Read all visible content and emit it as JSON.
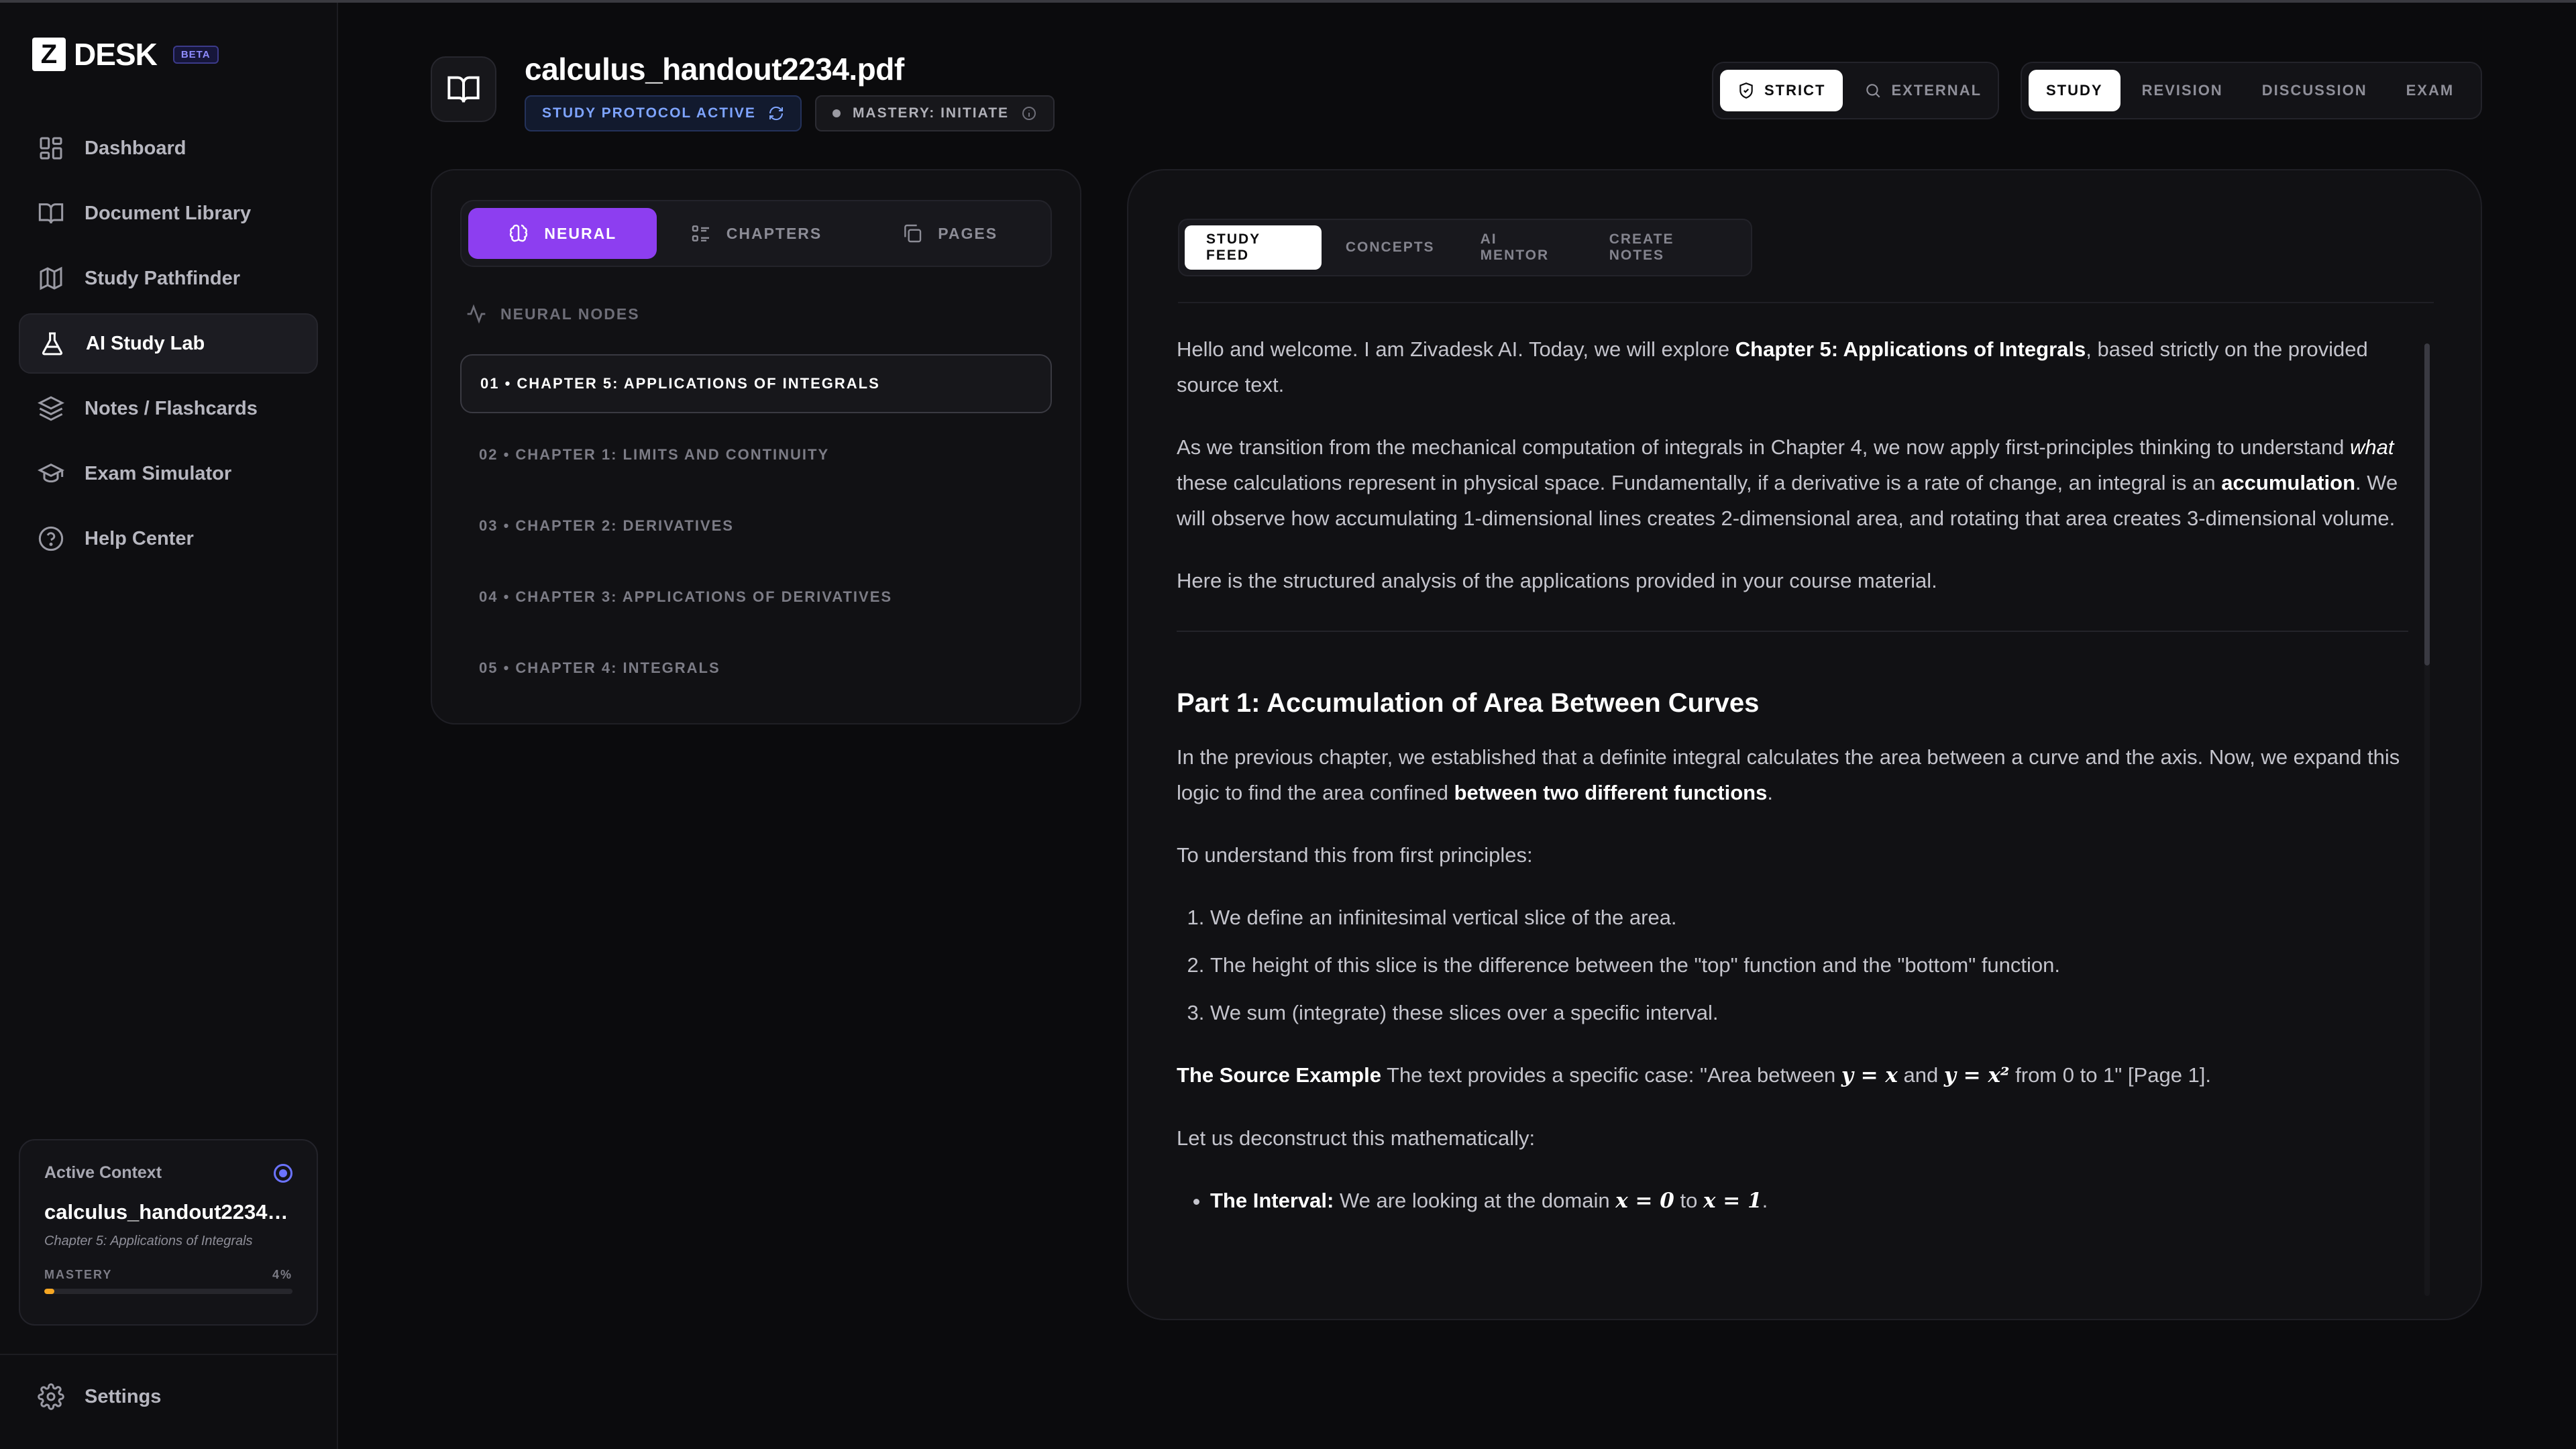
{
  "app": {
    "logo_mark": "Z",
    "logo_text": "DESK",
    "beta": "BETA"
  },
  "sidebar": {
    "items": [
      {
        "label": "Dashboard"
      },
      {
        "label": "Document Library"
      },
      {
        "label": "Study Pathfinder"
      },
      {
        "label": "AI Study Lab"
      },
      {
        "label": "Notes / Flashcards"
      },
      {
        "label": "Exam Simulator"
      },
      {
        "label": "Help Center"
      }
    ],
    "context": {
      "heading": "Active Context",
      "file": "calculus_handout2234.pdf",
      "chapter": "Chapter 5: Applications of Integrals",
      "mastery_label": "MASTERY",
      "mastery_value": "4%",
      "mastery_fraction": 0.04
    },
    "settings": "Settings"
  },
  "header": {
    "title": "calculus_handout2234.pdf",
    "protocol_badge": "STUDY PROTOCOL ACTIVE",
    "mastery_badge": "MASTERY: INITIATE",
    "source_modes": [
      "STRICT",
      "EXTERNAL"
    ],
    "study_modes": [
      "STUDY",
      "REVISION",
      "DISCUSSION",
      "EXAM"
    ]
  },
  "left_panel": {
    "tabs": [
      "NEURAL",
      "CHAPTERS",
      "PAGES"
    ],
    "nodes_heading": "NEURAL NODES",
    "nodes": [
      "01 • CHAPTER 5: APPLICATIONS OF INTEGRALS",
      "02 • CHAPTER 1: LIMITS AND CONTINUITY",
      "03 • CHAPTER 2: DERIVATIVES",
      "04 • CHAPTER 3: APPLICATIONS OF DERIVATIVES",
      "05 • CHAPTER 4: INTEGRALS"
    ]
  },
  "feed": {
    "tabs": [
      "STUDY FEED",
      "CONCEPTS",
      "AI MENTOR",
      "CREATE NOTES"
    ],
    "p1_a": "Hello and welcome. I am Zivadesk AI. Today, we will explore ",
    "p1_b": "Chapter 5: Applications of Integrals",
    "p1_c": ", based strictly on the provided source text.",
    "p2_a": "As we transition from the mechanical computation of integrals in Chapter 4, we now apply first-principles thinking to understand ",
    "p2_b": "what",
    "p2_c": " these calculations represent in physical space. Fundamentally, if a derivative is a rate of change, an integral is an ",
    "p2_d": "accumulation",
    "p2_e": ". We will observe how accumulating 1-dimensional lines creates 2-dimensional area, and rotating that area creates 3-dimensional volume.",
    "p3": "Here is the structured analysis of the applications provided in your course material.",
    "h2": "Part 1: Accumulation of Area Between Curves",
    "p4_a": "In the previous chapter, we established that a definite integral calculates the area between a curve and the axis. Now, we expand this logic to find the area confined ",
    "p4_b": "between two different functions",
    "p4_c": ".",
    "p5": "To understand this from first principles:",
    "steps": [
      "We define an infinitesimal vertical slice of the area.",
      "The height of this slice is the difference between the \"top\" function and the \"bottom\" function.",
      "We sum (integrate) these slices over a specific interval."
    ],
    "p6_label": "The Source Example",
    "p6_a": " The text provides a specific case: \"Area between ",
    "p6_m1": "y = x",
    "p6_b": " and ",
    "p6_m2": "y = x²",
    "p6_c": " from 0 to 1\" [Page 1].",
    "p7": "Let us deconstruct this mathematically:",
    "b1_label": "The Interval:",
    "b1_a": " We are looking at the domain ",
    "b1_m1": "x = 0",
    "b1_b": " to ",
    "b1_m2": "x = 1",
    "b1_c": "."
  }
}
